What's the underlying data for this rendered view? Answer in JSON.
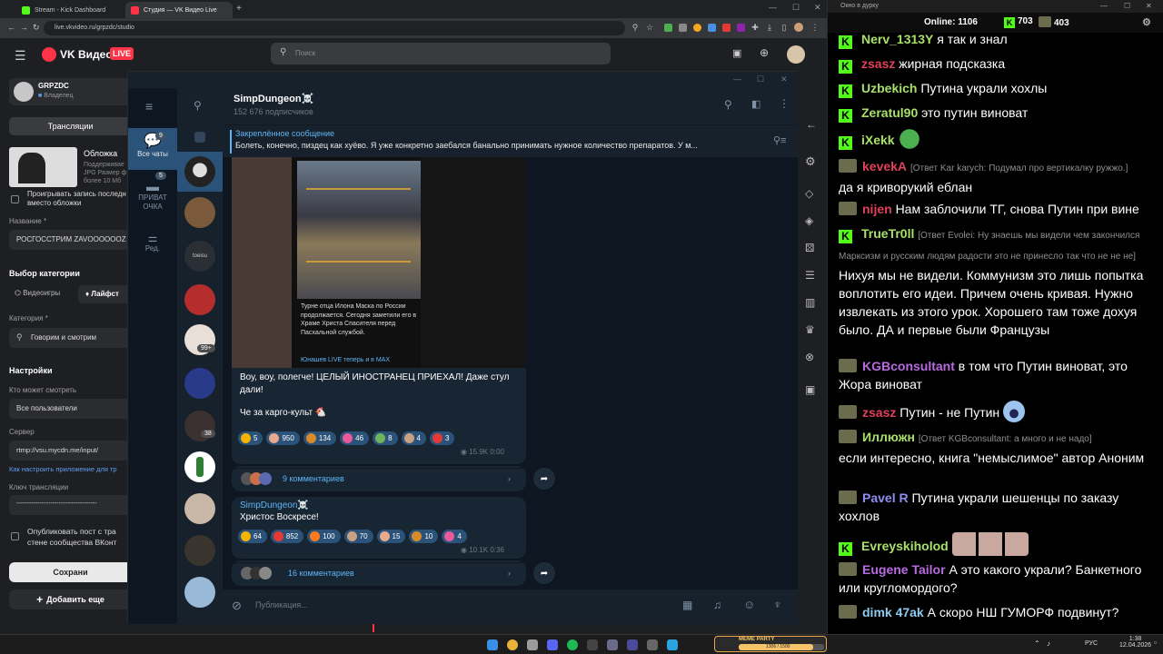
{
  "browser": {
    "tabs": [
      {
        "label": "Stream - Kick Dashboard"
      },
      {
        "label": "Студия — VK Видео Live"
      }
    ],
    "new_tab": "+",
    "url": "live.vkvideo.ru/grpzdc/studio",
    "window_controls": {
      "minimize": "—",
      "maximize": "☐",
      "close": "✕"
    }
  },
  "vk": {
    "logo_text": "VK Видео",
    "live_badge": "LIVE",
    "search_placeholder": "Поиск",
    "channel_name": "GRPZDC",
    "channel_role": "Владелец",
    "nav_broadcasts": "Трансляции",
    "cover_title": "Обложка",
    "cover_desc_1": "Поддерживае",
    "cover_desc_2": "JPG Размер ф",
    "cover_desc_3": "более 10 Мб",
    "replay_checkbox_1": "Проигрывать запись последн",
    "replay_checkbox_2": "вместо обложки",
    "name_label": "Название *",
    "name_value": "РОСГОССТРИМ ZAVOOOOOOZ",
    "category_section": "Выбор категории",
    "cat_games": "Видеоигры",
    "cat_lifestyle": "Лайфст",
    "category_label": "Категория *",
    "category_value": "Говорим и смотрим",
    "settings_title": "Настройки",
    "who_can_watch_label": "Кто может смотреть",
    "who_can_watch_value": "Все пользователи",
    "server_label": "Сервер",
    "server_value": "rtmp://vsu.mycdn.me/input/",
    "app_setup_link": "Как настроить приложение для тр",
    "key_label": "Ключ трансляции",
    "key_value": "--------------------------------------",
    "publish_checkbox_1": "Опубликовать пост с тра",
    "publish_checkbox_2": "стене сообщества ВКонт",
    "save_button": "Сохрани",
    "add_button": "Добавить еще"
  },
  "telegram": {
    "folders": [
      {
        "label": "Все чаты",
        "badge": "9"
      },
      {
        "label": "ПРИВАТ ОЧКА",
        "badge": "5"
      },
      {
        "label": "Ред.",
        "badge": ""
      }
    ],
    "chat_badges": [
      "99+",
      "38"
    ],
    "chat_labels": [
      "toeisu"
    ],
    "channel_title": "SimpDungeon☠️",
    "subscribers": "152 676 подписчиков",
    "pinned_title": "Закреплённое сообщение",
    "pinned_text": "Болеть, конечно, пиздец как хуёво. Я уже конкретно заебался банально принимать нужное количество препаратов. У м...",
    "post1": {
      "image_caption": "Турне отца Илона Маска по России продолжается. Сегодня заметили его в Храме Христа Спасителя перед Пасхальной службой.",
      "image_footer": "Юнашев LIVE теперь и в MAX",
      "text_1": "Воу, воу, полегче! ЦЕЛЫЙ ИНОСТРАНЕЦ ПРИЕХАЛ! Даже стул дали!",
      "text_2": "Че за карго-культ 🐔",
      "reactions": [
        {
          "count": "5",
          "color": "#f5b400"
        },
        {
          "count": "950",
          "color": "#e9a98a"
        },
        {
          "count": "134",
          "color": "#d98a2a"
        },
        {
          "count": "46",
          "color": "#e85a9a"
        },
        {
          "count": "8",
          "color": "#6fb35a"
        },
        {
          "count": "4",
          "color": "#c9a080"
        },
        {
          "count": "3",
          "color": "#e53935"
        }
      ],
      "views": "15.9K",
      "time": "0:00",
      "comments": "9 комментариев"
    },
    "post2": {
      "author": "SimpDungeon☠️",
      "text": "Христос Воскресе!",
      "reactions": [
        {
          "count": "64",
          "color": "#f5b400"
        },
        {
          "count": "852",
          "color": "#e53935"
        },
        {
          "count": "100",
          "color": "#ff7a1a"
        },
        {
          "count": "70",
          "color": "#c9a080"
        },
        {
          "count": "15",
          "color": "#e9a98a"
        },
        {
          "count": "10",
          "color": "#d98a2a"
        },
        {
          "count": "4",
          "color": "#e85a9a"
        }
      ],
      "views": "10.1K",
      "time": "0:36",
      "comments": "16 комментариев"
    },
    "compose_placeholder": "Публикация..."
  },
  "chat": {
    "window_title": "Окно в дурку",
    "online_label": "Online:",
    "online_count": "1106",
    "kick_count": "703",
    "vk_count": "403",
    "messages": [
      {
        "platform": "kick",
        "user": "Nerv_1313Y",
        "color": "#a8e06a",
        "reply": "",
        "text": "я так и знал"
      },
      {
        "platform": "kick",
        "user": "zsasz",
        "color": "#e0405a",
        "reply": "",
        "text": "жирная подсказка"
      },
      {
        "platform": "kick",
        "user": "Uzbekich",
        "color": "#a8e06a",
        "reply": "",
        "text": "Путина украли хохлы"
      },
      {
        "platform": "kick",
        "user": "Zeratul90",
        "color": "#a8e06a",
        "reply": "",
        "text": "это путин виноват"
      },
      {
        "platform": "kick",
        "user": "iXekk",
        "color": "#a8e06a",
        "reply": "",
        "text": "",
        "emote": "pepe"
      },
      {
        "platform": "vk",
        "user": "kevekA",
        "color": "#e0405a",
        "reply": "[Ответ Kar karych: Подумал про вертикалку ружжо.]",
        "text": "да я криворукий еблан"
      },
      {
        "platform": "vk",
        "user": "nijen",
        "color": "#e0405a",
        "reply": "",
        "text": "Нам заблочили ТГ, снова Путин при вине"
      },
      {
        "platform": "kick",
        "user": "TrueTr0ll",
        "color": "#a8e06a",
        "reply": "[Ответ Evolei: Ну знаешь мы видели чем закончился Марксизм и русским людям радости это не принесло так что не не не]",
        "text": "Нихуя мы не видели. Коммунизм это лишь попытка воплотить его идеи. Причем очень кривая. Нужно извлекать из этого урок. Хорошего там тоже дохуя было. ДА и первые были Французы"
      },
      {
        "platform": "vk",
        "user": "KGBconsultant",
        "color": "#b86be0",
        "reply": "",
        "text": "в том что Путин виноват, это Жора виноват"
      },
      {
        "platform": "vk",
        "user": "zsasz",
        "color": "#e0405a",
        "reply": "",
        "text": "Путин - не Путин",
        "emote": "shock"
      },
      {
        "platform": "vk",
        "user": "Иллюжн",
        "color": "#a8e06a",
        "reply": "[Ответ KGBconsultant: а много и не надо]",
        "text": "если интересно, книга \"немыслимое\" автор Аноним"
      },
      {
        "platform": "vk",
        "user": "Pavel R",
        "color": "#8e8ef0",
        "reply": "",
        "text": "Путина украли шешенцы по заказу хохлов"
      },
      {
        "platform": "kick",
        "user": "Evreyskiholod",
        "color": "#a8e06a",
        "reply": "",
        "text": "",
        "emote": "cats"
      },
      {
        "platform": "vk",
        "user": "Eugene Tailor",
        "color": "#b86be0",
        "reply": "",
        "text": "А это какого украли? Банкетного или кругломордого?"
      },
      {
        "platform": "vk",
        "user": "dimk 47ak",
        "color": "#8ecbf0",
        "reply": "",
        "text": "А скоро НШ ГУМОРФ подвинут?"
      }
    ]
  },
  "taskbar": {
    "lang": "РУС",
    "time": "1:38",
    "date": "12.04.2026",
    "meme_party": "MEME PARTY",
    "meme_progress": "1306 / 1500"
  }
}
